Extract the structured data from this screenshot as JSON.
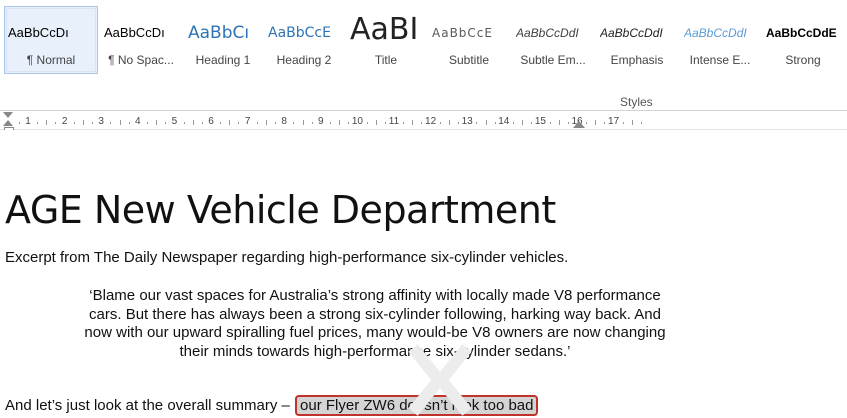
{
  "styles_gallery": {
    "group_label": "Styles",
    "tiles": [
      {
        "preview": "AaBbCcDı",
        "name": "¶ Normal"
      },
      {
        "preview": "AaBbCcDı",
        "name": "¶ No Spac..."
      },
      {
        "preview": "AaBbCı",
        "name": "Heading 1"
      },
      {
        "preview": "AaBbCcE",
        "name": "Heading 2"
      },
      {
        "preview": "AaBI",
        "name": "Title"
      },
      {
        "preview": "AaBbCcE",
        "name": "Subtitle"
      },
      {
        "preview": "AaBbCcDdI",
        "name": "Subtle Em..."
      },
      {
        "preview": "AaBbCcDdI",
        "name": "Emphasis"
      },
      {
        "preview": "AaBbCcDdI",
        "name": "Intense E..."
      },
      {
        "preview": "AaBbCcDdE",
        "name": "Strong"
      }
    ]
  },
  "ruler": {
    "numbers": [
      "1",
      "2",
      "3",
      "4",
      "5",
      "6",
      "7",
      "8",
      "9",
      "10",
      "11",
      "12",
      "13",
      "14",
      "15",
      "16",
      "17"
    ]
  },
  "document": {
    "title": "AGE New Vehicle Department",
    "intro": "Excerpt from The Daily Newspaper regarding high-performance six-cylinder vehicles.",
    "quote": "‘Blame our vast spaces for Australia’s strong affinity with locally made V8 performance cars. But there has always been a strong six-cylinder following, harking way back. And now with our upward spiralling fuel prices, many would-be V8 owners are now changing their minds towards high-performance six-cylinder sedans.’",
    "summary_lead": "And let’s just look at the overall summary –",
    "summary_highlight": "our Flyer ZW6 doesn’t look too bad"
  },
  "colors": {
    "heading_blue": "#2e74b5",
    "intense_blue": "#5b9bd5",
    "highlight_border": "#c0332b",
    "highlight_fill": "#d4d4d4"
  }
}
